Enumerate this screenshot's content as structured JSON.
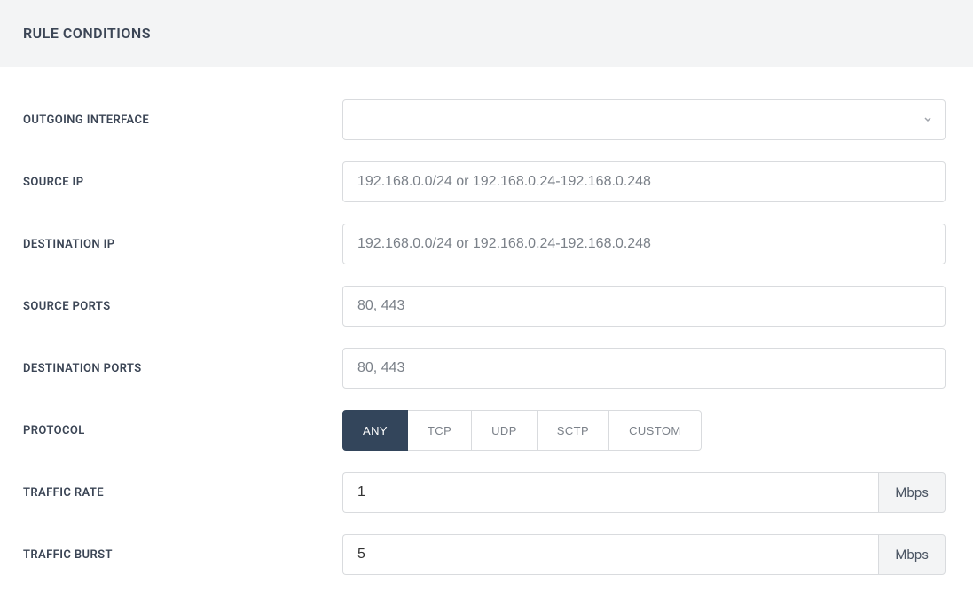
{
  "header": {
    "title": "RULE CONDITIONS"
  },
  "fields": {
    "outgoing_interface": {
      "label": "OUTGOING INTERFACE",
      "value": ""
    },
    "source_ip": {
      "label": "SOURCE IP",
      "placeholder": "192.168.0.0/24 or 192.168.0.24-192.168.0.248",
      "value": ""
    },
    "destination_ip": {
      "label": "DESTINATION IP",
      "placeholder": "192.168.0.0/24 or 192.168.0.24-192.168.0.248",
      "value": ""
    },
    "source_ports": {
      "label": "SOURCE PORTS",
      "placeholder": "80, 443",
      "value": ""
    },
    "destination_ports": {
      "label": "DESTINATION PORTS",
      "placeholder": "80, 443",
      "value": ""
    },
    "protocol": {
      "label": "PROTOCOL",
      "options": [
        "ANY",
        "TCP",
        "UDP",
        "SCTP",
        "CUSTOM"
      ],
      "selected": "ANY"
    },
    "traffic_rate": {
      "label": "TRAFFIC RATE",
      "value": "1",
      "unit": "Mbps"
    },
    "traffic_burst": {
      "label": "TRAFFIC BURST",
      "value": "5",
      "unit": "Mbps"
    }
  }
}
